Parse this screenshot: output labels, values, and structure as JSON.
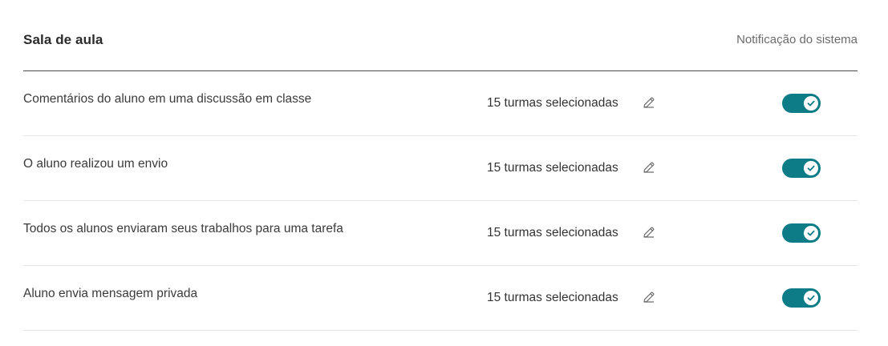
{
  "header": {
    "title": "Sala de aula",
    "column_label": "Notificação do sistema"
  },
  "colors": {
    "toggle_on": "#0e7c86",
    "divider": "#e6e6e6",
    "header_rule": "#4a4a4a"
  },
  "rows": [
    {
      "label": "Comentários do aluno em uma discussão em classe",
      "classes": "15 turmas selecionadas",
      "edit_icon": "pencil-icon",
      "toggle_on": true
    },
    {
      "label": "O aluno realizou um envio",
      "classes": "15 turmas selecionadas",
      "edit_icon": "pencil-icon",
      "toggle_on": true
    },
    {
      "label": "Todos os alunos enviaram seus trabalhos para uma tarefa",
      "classes": "15 turmas selecionadas",
      "edit_icon": "pencil-icon",
      "toggle_on": true
    },
    {
      "label": "Aluno envia mensagem privada",
      "classes": "15 turmas selecionadas",
      "edit_icon": "pencil-icon",
      "toggle_on": true
    }
  ]
}
